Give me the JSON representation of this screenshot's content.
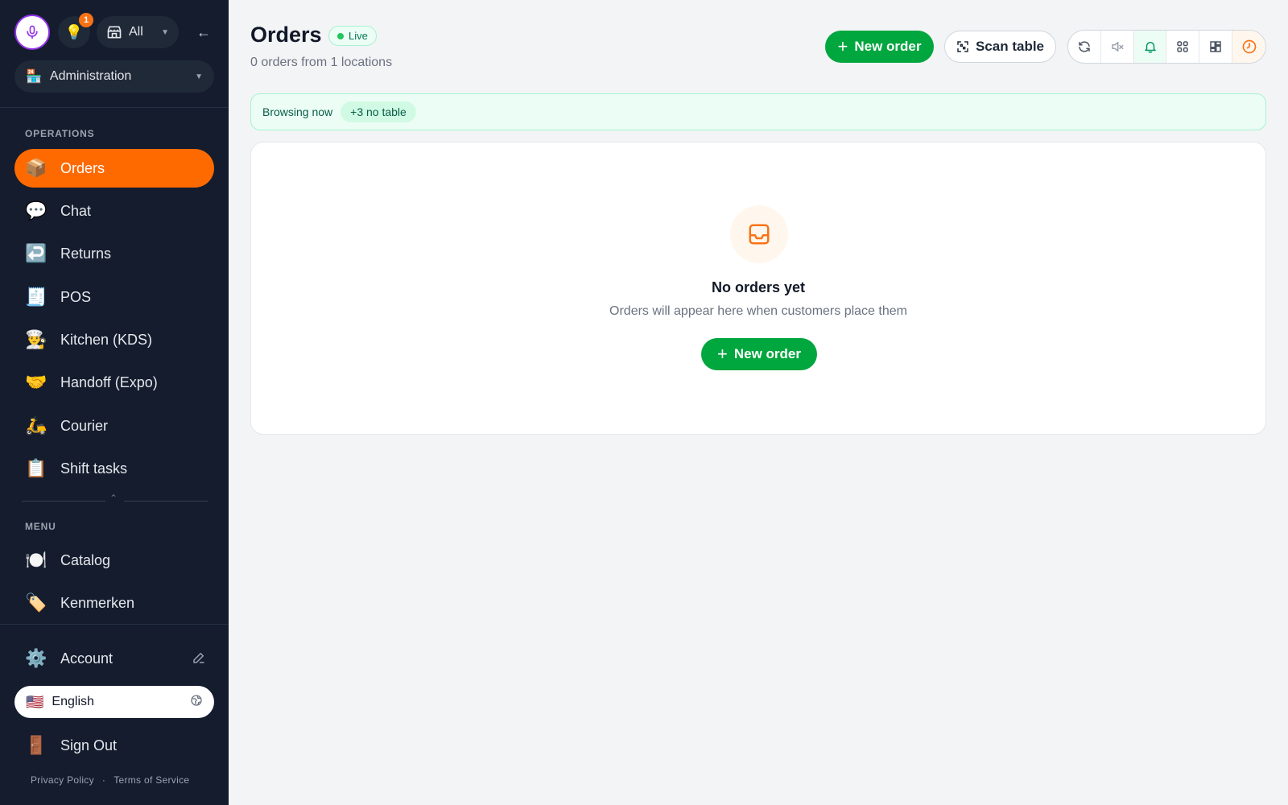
{
  "sidebar": {
    "store_filter": {
      "label": "All",
      "icon": "store-icon"
    },
    "notification_count": "1",
    "role_select": {
      "emoji": "🏪",
      "label": "Administration"
    },
    "sections": {
      "operations": "OPERATIONS",
      "menu": "MENU"
    },
    "operations_items": [
      {
        "emoji": "📦",
        "label": "Orders",
        "active": true
      },
      {
        "emoji": "💬",
        "label": "Chat"
      },
      {
        "emoji": "↩️",
        "label": "Returns"
      },
      {
        "emoji": "🧾",
        "label": "POS"
      },
      {
        "emoji": "👨‍🍳",
        "label": "Kitchen (KDS)"
      },
      {
        "emoji": "🤝",
        "label": "Handoff (Expo)"
      },
      {
        "emoji": "🛵",
        "label": "Courier"
      },
      {
        "emoji": "📋",
        "label": "Shift tasks"
      }
    ],
    "menu_items": [
      {
        "emoji": "🍽️",
        "label": "Catalog"
      },
      {
        "emoji": "🏷️",
        "label": "Kenmerken"
      }
    ],
    "account": {
      "emoji": "⚙️",
      "label": "Account"
    },
    "language": {
      "flag": "🇺🇸",
      "label": "English"
    },
    "sign_out": {
      "emoji": "🚪",
      "label": "Sign Out"
    },
    "footer": {
      "privacy": "Privacy Policy",
      "separator": "·",
      "terms": "Terms of Service"
    }
  },
  "header": {
    "title": "Orders",
    "live_label": "Live",
    "subtitle": "0 orders from 1 locations",
    "new_order_label": "New order",
    "scan_table_label": "Scan table",
    "toolbar_icons": [
      "refresh-icon",
      "mute-icon",
      "bell-icon",
      "grid-icon",
      "dashboard-icon",
      "clock-icon"
    ]
  },
  "browsing": {
    "label": "Browsing now",
    "pill": "+3 no table"
  },
  "empty_state": {
    "title": "No orders yet",
    "subtitle": "Orders will appear here when customers place them",
    "button_label": "New order"
  },
  "colors": {
    "sidebar_bg": "#141c2e",
    "accent_orange": "#ff6a00",
    "primary_green": "#00a63e",
    "mic_ring": "#9333ea"
  }
}
